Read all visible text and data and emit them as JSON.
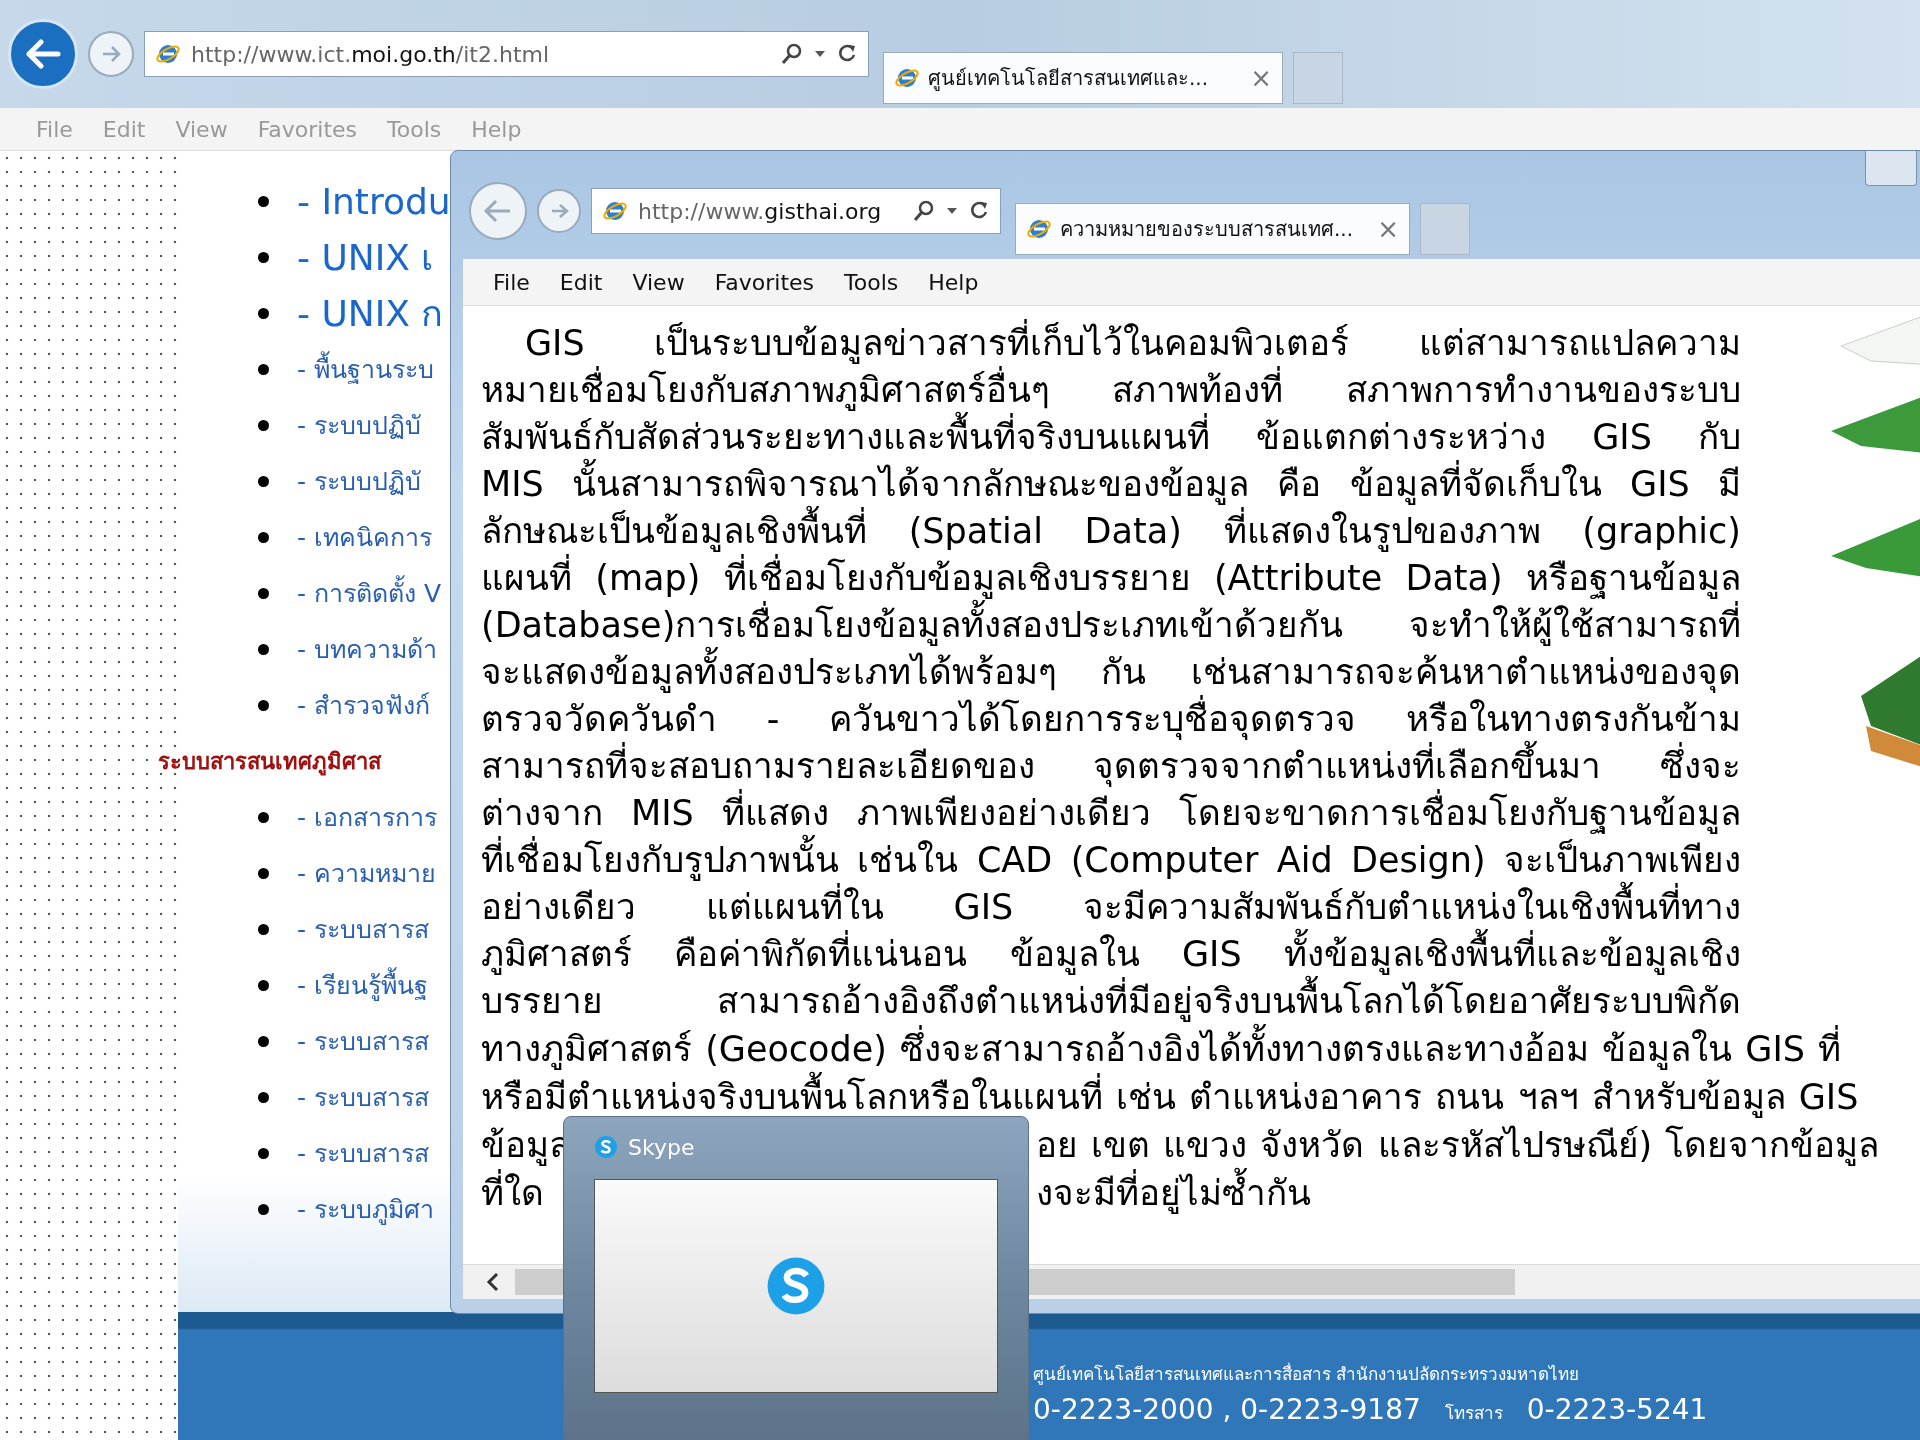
{
  "back_window": {
    "active": false,
    "address": {
      "prefix": "http://www.ict.",
      "domain": "moi.go.th",
      "suffix": "/it2.html"
    },
    "tabs": [
      {
        "title": "ศูนย์เทคโนโลยีสารสนเทศและ...",
        "close": "×",
        "selected": true
      }
    ],
    "menu": [
      "File",
      "Edit",
      "View",
      "Favorites",
      "Tools",
      "Help"
    ],
    "list_items": [
      {
        "kind": "large",
        "text": "- Introdu"
      },
      {
        "kind": "large",
        "text": "- UNIX เ"
      },
      {
        "kind": "large",
        "text": "- UNIX ก"
      },
      {
        "kind": "link",
        "text": "- พื้นฐานระบ"
      },
      {
        "kind": "link",
        "text": "- ระบบปฏิบั"
      },
      {
        "kind": "link",
        "text": "- ระบบปฏิบั"
      },
      {
        "kind": "link",
        "text": "- เทคนิคการ"
      },
      {
        "kind": "link",
        "text": "- การติดตั้ง V"
      },
      {
        "kind": "link",
        "text": "- บทความด้า"
      },
      {
        "kind": "link",
        "text": "- สำรวจฟังก์"
      },
      {
        "kind": "heading",
        "text": "ระบบสารสนเทศภูมิศาส"
      },
      {
        "kind": "link",
        "text": "- เอกสารการ"
      },
      {
        "kind": "link",
        "text": "- ความหมาย"
      },
      {
        "kind": "link",
        "text": "- ระบบสารส"
      },
      {
        "kind": "link",
        "text": "- เรียนรู้พื้นฐ"
      },
      {
        "kind": "link",
        "text": "- ระบบสารส"
      },
      {
        "kind": "link",
        "text": "- ระบบสารส"
      },
      {
        "kind": "link",
        "text": "- ระบบสารส"
      },
      {
        "kind": "link",
        "text": "- ระบบภูมิศา"
      }
    ],
    "footer": {
      "line1": "ศูนย์เทคโนโลยีสารสนเทศและการสื่อสาร  สำนักงานปลัดกระทรวงมหาดไทย",
      "phone": "0-2223-2000 , 0-2223-9187",
      "fax_label": "โทรสาร",
      "fax": "0-2223-5241"
    }
  },
  "front_window": {
    "active": true,
    "address": {
      "prefix": "http://www.",
      "domain": "gisthai.org"
    },
    "tabs": [
      {
        "title": "ความหมายของระบบสารสนเทศ...",
        "close": "×",
        "selected": true
      }
    ],
    "menu": [
      "File",
      "Edit",
      "View",
      "Favorites",
      "Tools",
      "Help"
    ],
    "paragraph_lines": [
      {
        "kind": "first",
        "text": "GIS เป็นระบบข้อมูลข่าวสารที่เก็บไว้ในคอมพิวเตอร์ แต่สามารถแปลความ"
      },
      {
        "kind": "justified",
        "text": "หมายเชื่อมโยงกับสภาพภูมิศาสตร์อื่นๆ สภาพท้องที่ สภาพการทำงานของระบบ"
      },
      {
        "kind": "justified",
        "text": "สัมพันธ์กับสัดส่วนระยะทางและพื้นที่จริงบนแผนที่ ข้อแตกต่างระหว่าง GIS กับ"
      },
      {
        "kind": "justified",
        "text": "MIS นั้นสามารถพิจารณาได้จากลักษณะของข้อมูล คือ ข้อมูลที่จัดเก็บใน GIS มี"
      },
      {
        "kind": "justified",
        "text": "ลักษณะเป็นข้อมูลเชิงพื้นที่ (Spatial Data) ที่แสดงในรูปของภาพ (graphic)"
      },
      {
        "kind": "justified",
        "text": "แผนที่ (map) ที่เชื่อมโยงกับข้อมูลเชิงบรรยาย (Attribute Data) หรือฐานข้อมูล"
      },
      {
        "kind": "justified",
        "text": "(Database)การเชื่อมโยงข้อมูลทั้งสองประเภทเข้าด้วยกัน จะทำให้ผู้ใช้สามารถที่"
      },
      {
        "kind": "justified",
        "text": "จะแสดงข้อมูลทั้งสองประเภทได้พร้อมๆ กัน เช่นสามารถจะค้นหาตำแหน่งของจุด"
      },
      {
        "kind": "justified",
        "text": "ตรวจวัดควันดำ - ควันขาวได้โดยการระบุชื่อจุดตรวจ หรือในทางตรงกันข้าม"
      },
      {
        "kind": "justified",
        "text": "สามารถที่จะสอบถามรายละเอียดของ จุดตรวจจากตำแหน่งที่เลือกขึ้นมา ซึ่งจะ"
      },
      {
        "kind": "justified",
        "text": "ต่างจาก MIS ที่แสดง ภาพเพียงอย่างเดียว โดยจะขาดการเชื่อมโยงกับฐานข้อมูล"
      },
      {
        "kind": "justified",
        "text": "ที่เชื่อมโยงกับรูปภาพนั้น เช่นใน CAD (Computer Aid Design) จะเป็นภาพเพียง"
      },
      {
        "kind": "justified",
        "text": "อย่างเดียว แต่แผนที่ใน GIS จะมีความสัมพันธ์กับตำแหน่งในเชิงพื้นที่ทาง"
      },
      {
        "kind": "justified",
        "text": "ภูมิศาสตร์ คือค่าพิกัดที่แน่นอน ข้อมูลใน GIS ทั้งข้อมูลเชิงพื้นที่และข้อมูลเชิง"
      },
      {
        "kind": "justified",
        "text": "บรรยาย สามารถอ้างอิงถึงตำแหน่งที่มีอยู่จริงบนพื้นโลกได้โดยอาศัยระบบพิกัด"
      },
      {
        "kind": "wide",
        "text": "ทางภูมิศาสตร์ (Geocode) ซึ่งจะสามารถอ้างอิงได้ทั้งทางตรงและทางอ้อม ข้อมูลใน GIS ที่"
      },
      {
        "kind": "wide",
        "text": "หรือมีตำแหน่งจริงบนพื้นโลกหรือในแผนที่ เช่น ตำแหน่งอาคาร ถนน ฯลฯ สำหรับข้อมูล GIS"
      }
    ],
    "split_lines": [
      {
        "left": "ข้อมูล",
        "right": "อย เขต แขวง จังหวัด และรหัสไปรษณีย์) โดยจากข้อมูล"
      },
      {
        "left": "ที่ใด",
        "right": "งจะมีที่อยู่ไม่ซ้ำกัน"
      }
    ]
  },
  "skype": {
    "title": "Skype"
  }
}
